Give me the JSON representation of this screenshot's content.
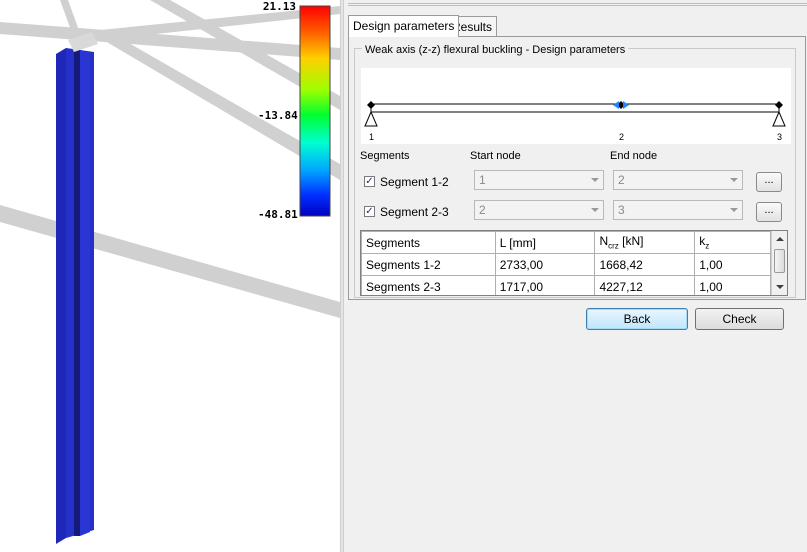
{
  "viewport": {
    "legend": {
      "max": "21.13",
      "mid": "-13.84",
      "min": "-48.81"
    }
  },
  "tabs": [
    {
      "label": "Design parameters",
      "active": true
    },
    {
      "label": "Results",
      "active": false
    }
  ],
  "group_title": "Weak axis (z-z) flexural buckling - Design parameters",
  "beam": {
    "nodes": [
      "1",
      "2",
      "3"
    ]
  },
  "segments_header": {
    "segments": "Segments",
    "start_node": "Start node",
    "end_node": "End node"
  },
  "segments": [
    {
      "label": "Segment 1-2",
      "checked": true,
      "start": "1",
      "end": "2",
      "button": "..."
    },
    {
      "label": "Segment 2-3",
      "checked": true,
      "start": "2",
      "end": "3",
      "button": "..."
    }
  ],
  "table": {
    "columns": [
      "Segments",
      "L [mm]",
      "Ncrz [kN]",
      "kz"
    ],
    "rows": [
      [
        "Segments 1-2",
        "2733,00",
        "1668,42",
        "1,00"
      ],
      [
        "Segments 2-3",
        "1717,00",
        "4227,12",
        "1,00"
      ]
    ]
  },
  "buttons": {
    "back": "Back",
    "check": "Check"
  },
  "colors": {
    "member_blue": "#1f27b8",
    "default_button_border": "#3c7fb1"
  }
}
